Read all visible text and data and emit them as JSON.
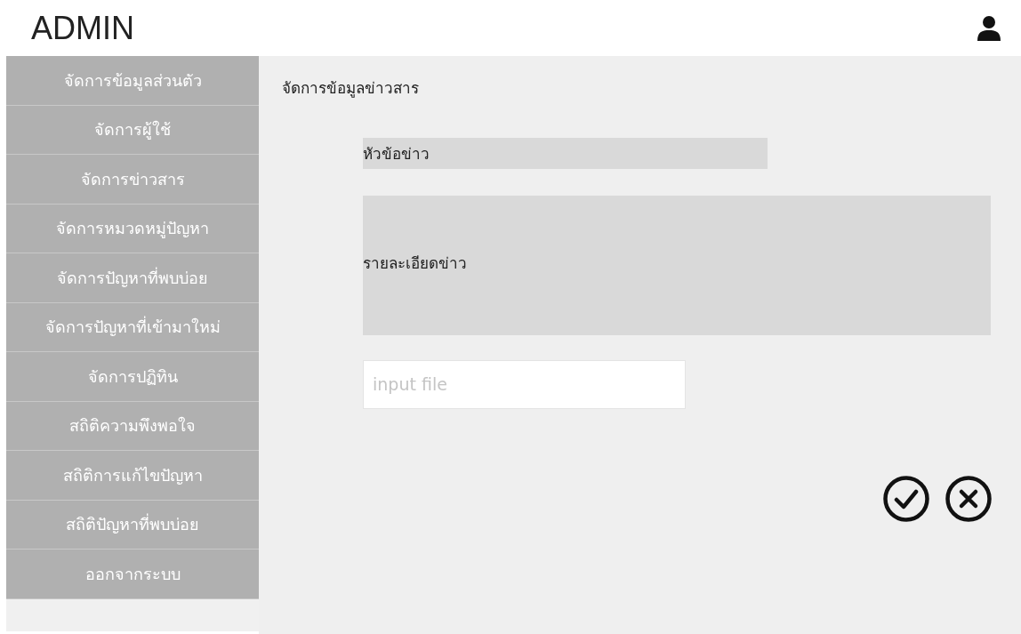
{
  "header": {
    "title": "ADMIN"
  },
  "sidebar": {
    "items": [
      {
        "label": "จัดการข้อมูลส่วนตัว"
      },
      {
        "label": "จัดการผู้ใช้"
      },
      {
        "label": "จัดการข่าวสาร"
      },
      {
        "label": "จัดการหมวดหมู่ปัญหา"
      },
      {
        "label": "จัดการปัญหาที่พบบ่อย"
      },
      {
        "label": "จัดการปัญหาที่เข้ามาใหม่"
      },
      {
        "label": "จัดการปฏิทิน"
      },
      {
        "label": "สถิติความพึงพอใจ"
      },
      {
        "label": "สถิติการแก้ไขปัญหา"
      },
      {
        "label": "สถิติปัญหาที่พบบ่อย"
      },
      {
        "label": "ออกจากระบบ"
      }
    ]
  },
  "main": {
    "title": "จัดการข้อมูลข่าวสาร",
    "headline_field": {
      "value": "หัวข้อข่าว"
    },
    "details_field": {
      "value": "รายละเอียดข่าว"
    },
    "file_field": {
      "placeholder": "input file"
    }
  }
}
